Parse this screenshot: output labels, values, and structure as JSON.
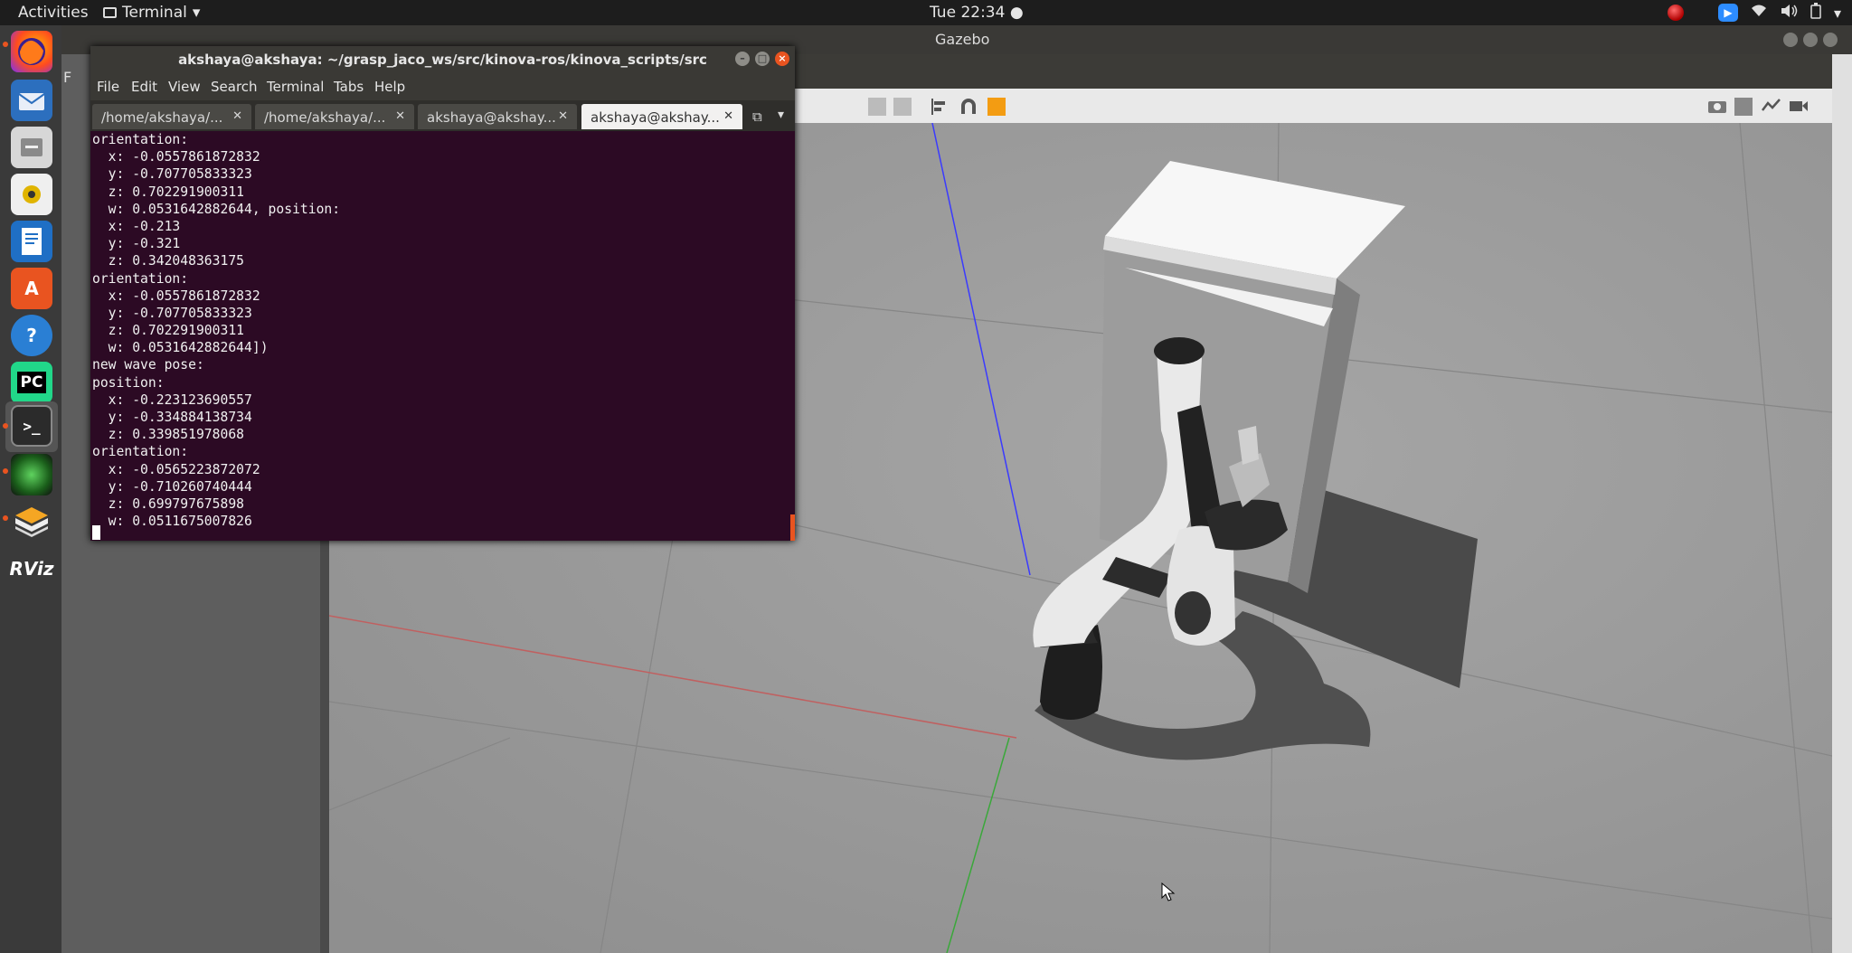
{
  "topbar": {
    "activities": "Activities",
    "app_name": "Terminal",
    "clock": "Tue 22:34 ●"
  },
  "dock": {
    "items": [
      "firefox-icon",
      "thunderbird-icon",
      "files-icon",
      "rhythmbox-icon",
      "writer-icon",
      "software-icon",
      "help-icon",
      "pycharm-icon",
      "terminal-icon",
      "camera-icon",
      "blocks-icon",
      "rviz-icon"
    ],
    "pycharm_label": "PC",
    "rviz_label": "RViz"
  },
  "gazebo": {
    "title": "Gazebo",
    "left_menu_stub": "F"
  },
  "terminal": {
    "title": "akshaya@akshaya: ~/grasp_jaco_ws/src/kinova-ros/kinova_scripts/src",
    "menu": [
      "File",
      "Edit",
      "View",
      "Search",
      "Terminal",
      "Tabs",
      "Help"
    ],
    "tabs": [
      "/home/akshaya/...",
      "/home/akshaya/...",
      "akshaya@akshay...",
      "akshaya@akshay..."
    ],
    "lines": [
      "orientation:",
      "  x: -0.0557861872832",
      "  y: -0.707705833323",
      "  z: 0.702291900311",
      "  w: 0.0531642882644, position:",
      "  x: -0.213",
      "  y: -0.321",
      "  z: 0.342048363175",
      "orientation:",
      "  x: -0.0557861872832",
      "  y: -0.707705833323",
      "  z: 0.702291900311",
      "  w: 0.0531642882644])",
      "new wave pose:",
      "position:",
      "  x: -0.223123690557",
      "  y: -0.334884138734",
      "  z: 0.339851978068",
      "orientation:",
      "  x: -0.0565223872072",
      "  y: -0.710260740444",
      "  z: 0.699797675898",
      "  w: 0.0511675007826"
    ]
  },
  "colors": {
    "terminal_bg": "#2c0a24",
    "accent": "#e95420",
    "gazebo_floor": "#9a9a9a"
  }
}
